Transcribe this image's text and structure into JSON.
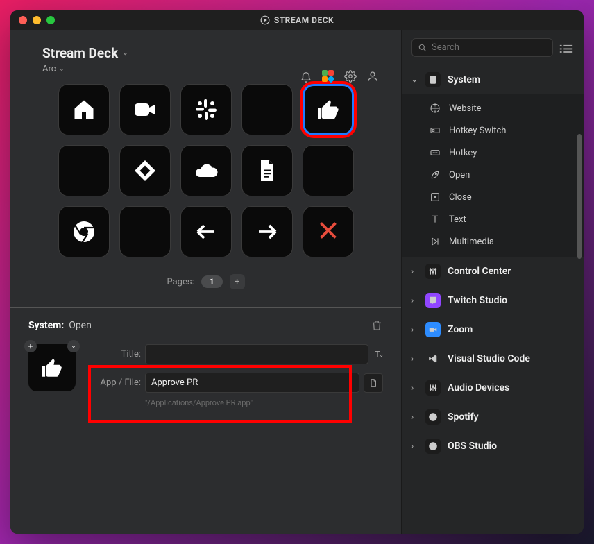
{
  "window": {
    "title": "STREAM DECK"
  },
  "profile": {
    "name": "Stream Deck",
    "folder": "Arc"
  },
  "toolbar": {
    "notifications_icon": "bell-icon",
    "plugins_icon": "plugins-icon",
    "settings_icon": "gear-icon",
    "account_icon": "person-icon"
  },
  "grid": {
    "cols": 5,
    "rows": 3,
    "keys": [
      {
        "icon": "home",
        "label": "",
        "interactable": true
      },
      {
        "icon": "camera",
        "label": "",
        "interactable": true
      },
      {
        "icon": "slack",
        "label": "",
        "interactable": true
      },
      {
        "icon": "",
        "label": "",
        "interactable": true
      },
      {
        "icon": "thumbs-up",
        "label": "",
        "interactable": true,
        "selected": true,
        "highlight_red": true
      },
      {
        "icon": "",
        "label": "",
        "interactable": true
      },
      {
        "icon": "jira",
        "label": "",
        "interactable": true
      },
      {
        "icon": "cloud",
        "label": "",
        "interactable": true
      },
      {
        "icon": "document",
        "label": "",
        "interactable": true
      },
      {
        "icon": "",
        "label": "",
        "interactable": true
      },
      {
        "icon": "chrome",
        "label": "",
        "interactable": true
      },
      {
        "icon": "",
        "label": "",
        "interactable": true
      },
      {
        "icon": "arrow-left",
        "label": "",
        "interactable": true
      },
      {
        "icon": "arrow-right",
        "label": "",
        "interactable": true
      },
      {
        "icon": "close-x",
        "label": "",
        "interactable": true
      }
    ]
  },
  "pages": {
    "label": "Pages:",
    "current": "1",
    "add_label": "+"
  },
  "inspector": {
    "category": "System:",
    "action": "Open",
    "title_label": "Title:",
    "title_value": "",
    "appfile_label": "App / File:",
    "appfile_value": "Approve PR",
    "appfile_help": "\"/Applications/Approve PR.app\"",
    "highlight_red": true
  },
  "right": {
    "search_placeholder": "Search",
    "categories": [
      {
        "name": "System",
        "icon": "system",
        "expanded": true,
        "items": [
          {
            "icon": "globe",
            "label": "Website"
          },
          {
            "icon": "hotkey-switch",
            "label": "Hotkey Switch"
          },
          {
            "icon": "hotkey",
            "label": "Hotkey"
          },
          {
            "icon": "rocket",
            "label": "Open"
          },
          {
            "icon": "close",
            "label": "Close"
          },
          {
            "icon": "text",
            "label": "Text"
          },
          {
            "icon": "multimedia",
            "label": "Multimedia"
          }
        ]
      },
      {
        "name": "Control Center",
        "icon": "sliders",
        "expanded": false
      },
      {
        "name": "Twitch Studio",
        "icon": "twitch",
        "expanded": false
      },
      {
        "name": "Zoom",
        "icon": "zoom",
        "expanded": false
      },
      {
        "name": "Visual Studio Code",
        "icon": "vscode",
        "expanded": false
      },
      {
        "name": "Audio Devices",
        "icon": "audio",
        "expanded": false
      },
      {
        "name": "Spotify",
        "icon": "spotify",
        "expanded": false
      },
      {
        "name": "OBS Studio",
        "icon": "obs",
        "expanded": false
      }
    ]
  }
}
